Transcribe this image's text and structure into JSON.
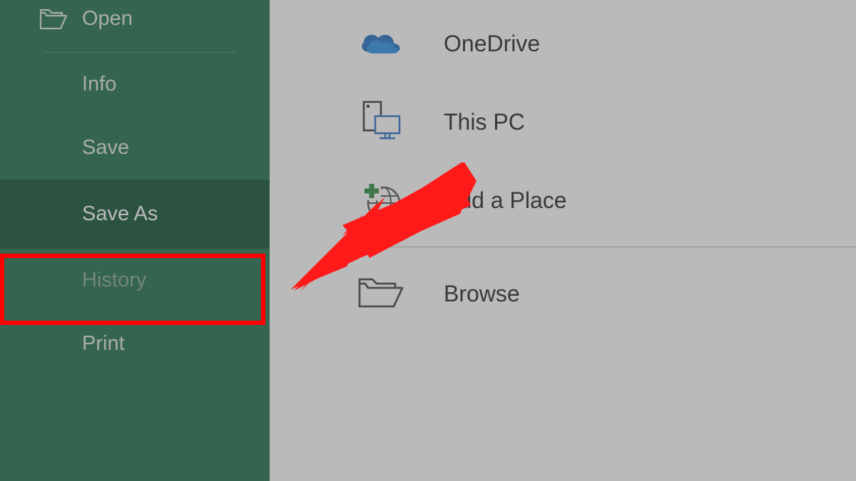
{
  "sidebar": {
    "open": "Open",
    "info": "Info",
    "save": "Save",
    "saveAs": "Save As",
    "history": "History",
    "print": "Print"
  },
  "locations": {
    "onedrive": "OneDrive",
    "thispc": "This PC",
    "addplace": "Add a Place",
    "browse": "Browse"
  }
}
